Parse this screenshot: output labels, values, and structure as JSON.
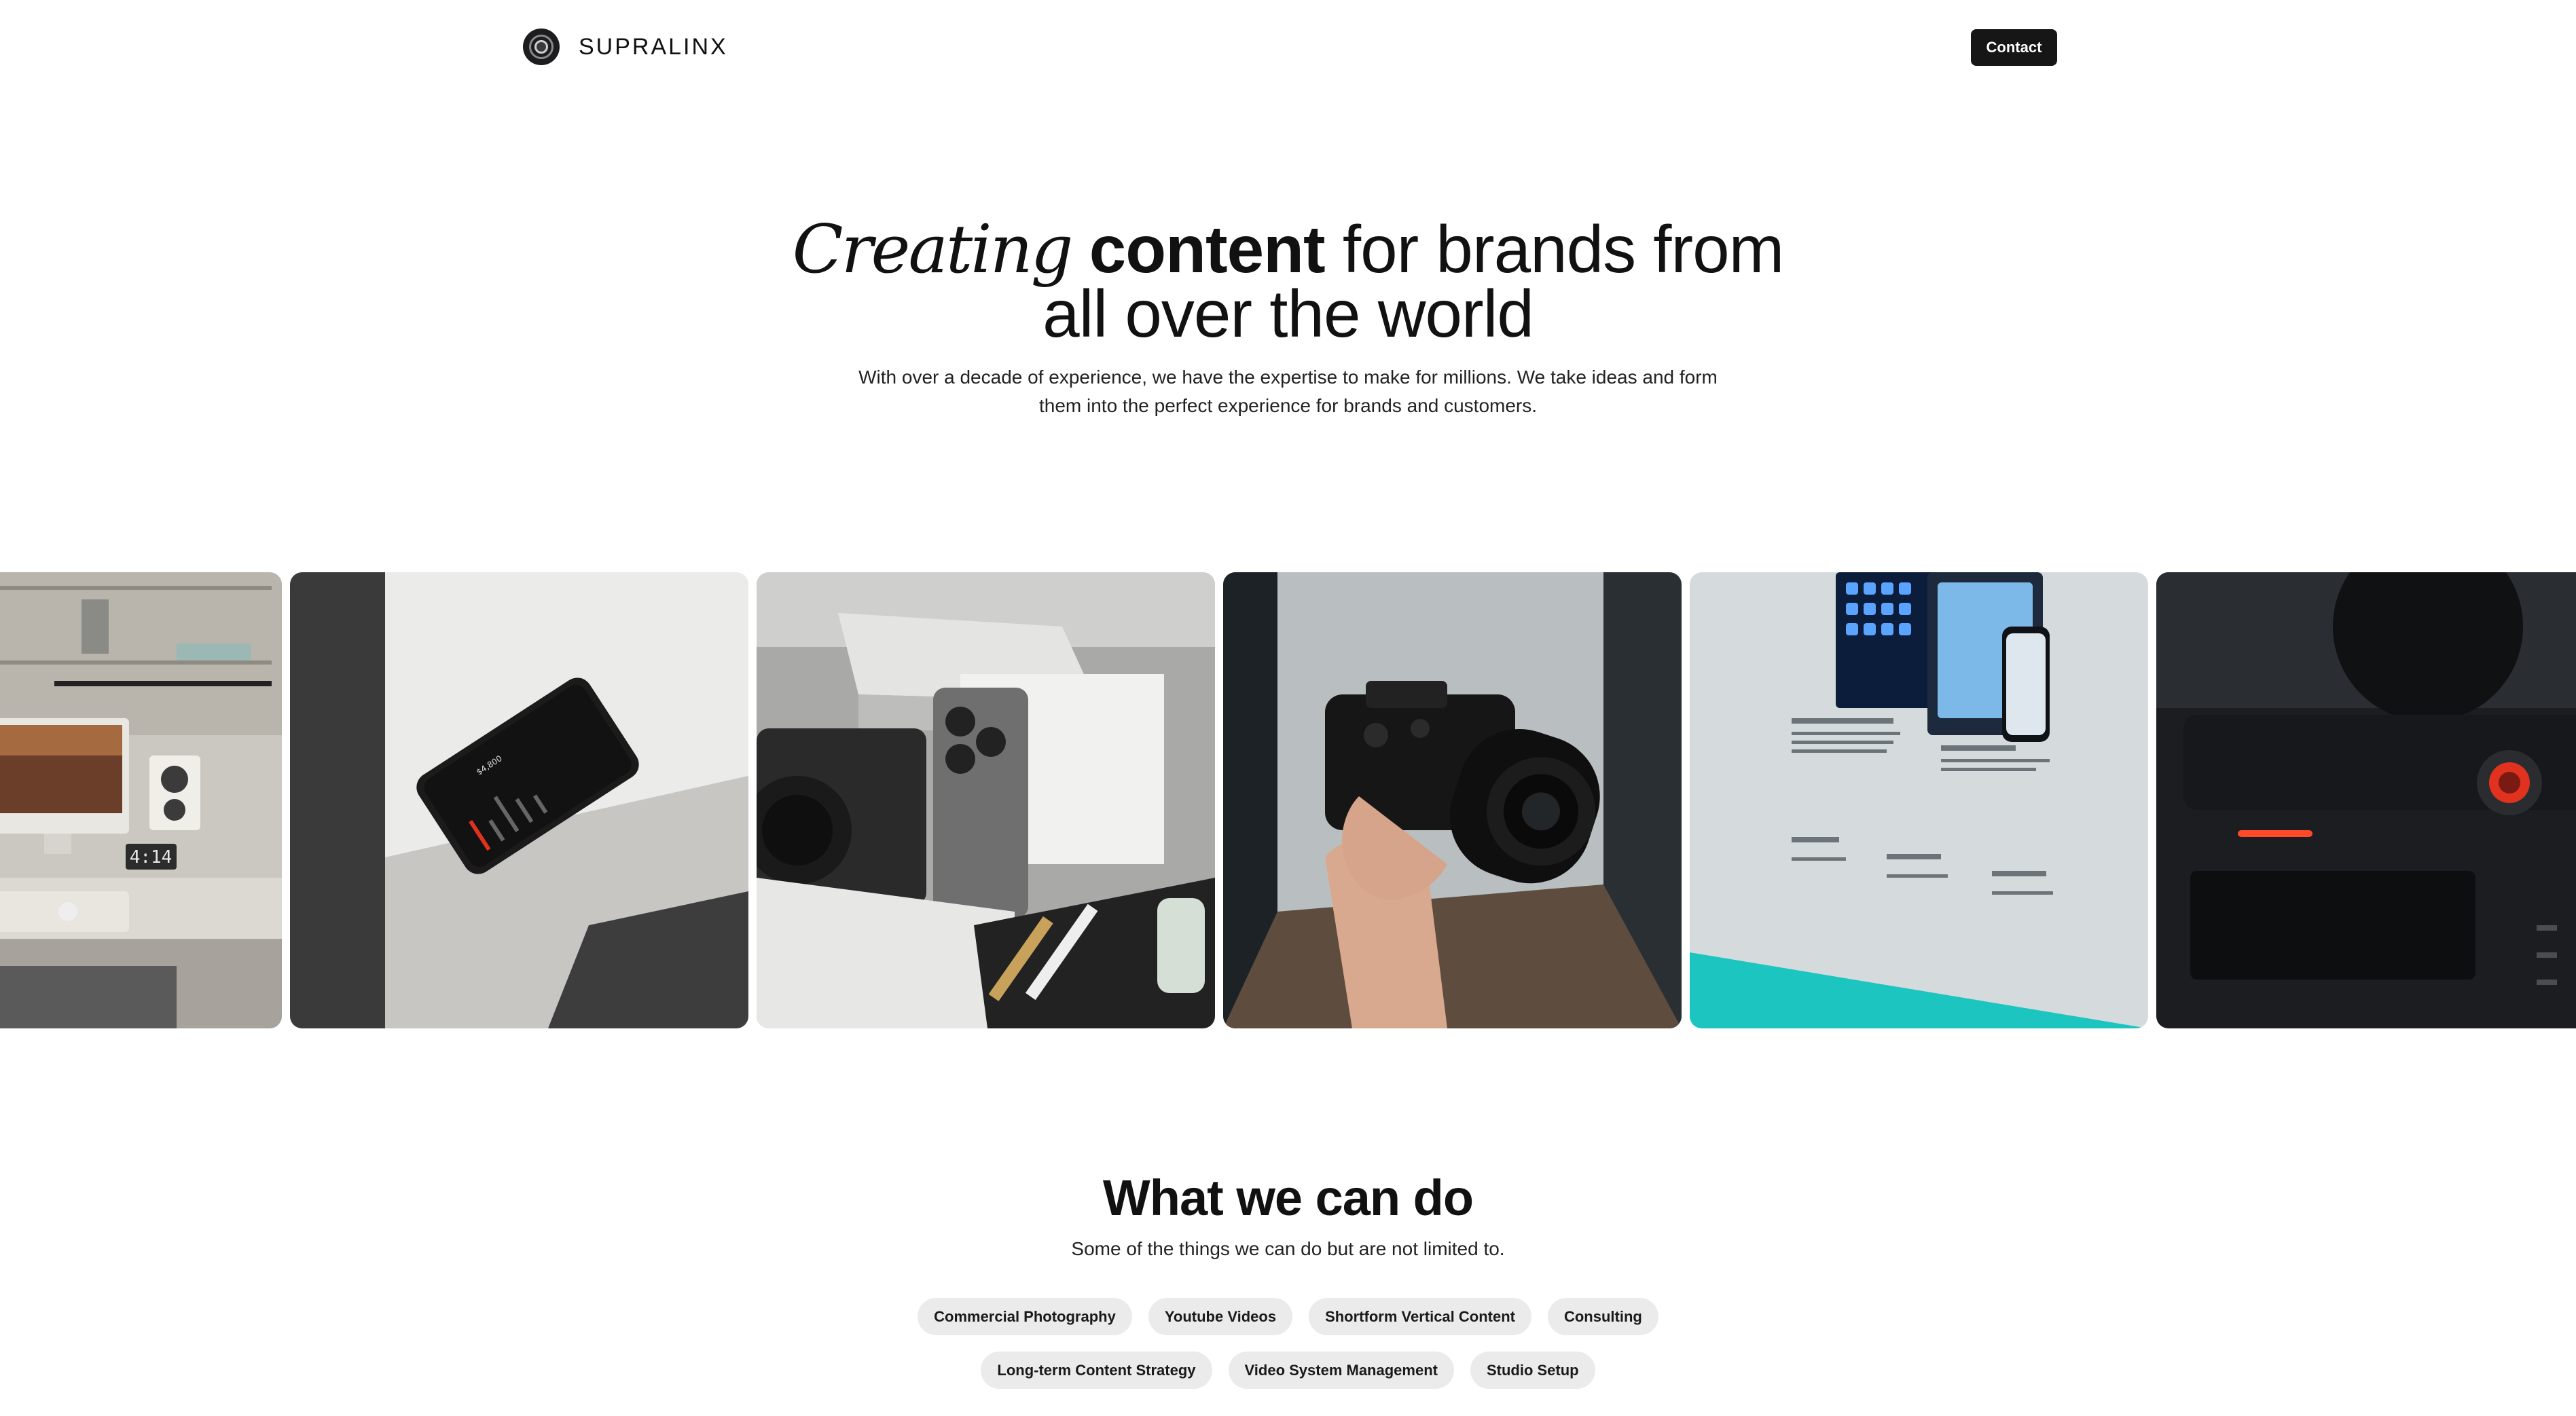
{
  "nav": {
    "brand_name": "SUPRALINX",
    "logo_icon": "aperture-logo-icon",
    "contact_label": "Contact"
  },
  "hero": {
    "title_italic": "Creating",
    "title_bold": "content",
    "title_rest_line1": "for brands from",
    "title_line2": "all over the world",
    "subtitle_line1": "With over a decade of experience, we have the expertise to make for millions. We take ideas and form",
    "subtitle_line2": "them into the perfect experience for brands and customers."
  },
  "gallery": {
    "items": [
      {
        "name": "desk-setup-image",
        "subject": "desk setup",
        "clock_text": "4:14"
      },
      {
        "name": "phone-on-concrete-image",
        "subject": "phone on concrete"
      },
      {
        "name": "camera-and-phone-flatlay-image",
        "subject": "camera and phone"
      },
      {
        "name": "hand-holding-camera-image",
        "subject": "hand holding camera"
      },
      {
        "name": "app-print-layout-image",
        "subject": "printed app layout"
      },
      {
        "name": "camera-closeup-image",
        "subject": "camera close-up"
      }
    ]
  },
  "services": {
    "title": "What we can do",
    "subtitle": "Some of the things we can do but are not limited to.",
    "row1": [
      "Commercial Photography",
      "Youtube Videos",
      "Shortform Vertical Content",
      "Consulting"
    ],
    "row2": [
      "Long-term Content Strategy",
      "Video System Management",
      "Studio Setup"
    ]
  },
  "colors": {
    "button_bg": "#161616",
    "chip_bg": "#ebebeb",
    "text": "#111111",
    "accent_red": "#e0321e",
    "accent_teal": "#1cc5c0"
  }
}
